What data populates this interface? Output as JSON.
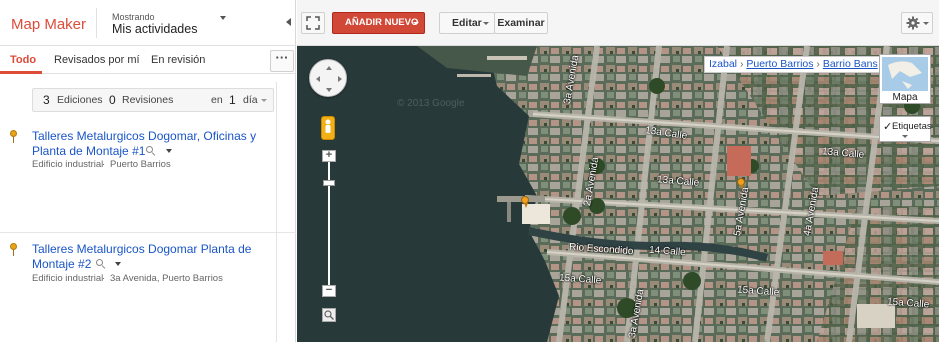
{
  "app": {
    "logo": "Map Maker",
    "showing_label": "Mostrando",
    "showing_value": "Mis actividades"
  },
  "tabs": [
    {
      "label": "Todo",
      "active": true
    },
    {
      "label": "Revisados por mí",
      "active": false
    },
    {
      "label": "En revisión",
      "active": false
    }
  ],
  "summary": {
    "edits_count": "3",
    "edits_label": "Ediciones",
    "revisions_count": "0",
    "revisions_label": "Revisiones",
    "in_label": "en",
    "days_count": "1",
    "day_label": "día"
  },
  "items": [
    {
      "title_line1": "Talleres Metalurgicos Dogomar, Oficinas y",
      "title_line2": "Planta de Montaje #1",
      "category": "Edificio industrial",
      "location": "Puerto Barrios"
    },
    {
      "title_line1": "Talleres Metalurgicos Dogomar Planta de",
      "title_line2": "Montaje #2",
      "category": "Edificio industrial",
      "location": "3a Avenida, Puerto Barrios"
    }
  ],
  "toolbar": {
    "add_new": "AÑADIR NUEVO",
    "edit": "Editar",
    "browse": "Examinar"
  },
  "map": {
    "breadcrumbs": [
      "Izabal",
      "Puerto Barrios",
      "Barrio Bans"
    ],
    "map_type_label": "Mapa",
    "labels_toggle": "Etiquetas",
    "labels_checked": true,
    "watermark": "© 2013 Google",
    "street_labels": [
      "3a Avenida",
      "13a Calle",
      "2a Avenida",
      "5a Avenida",
      "4a Avenida",
      "13a Calle",
      "13a Calle",
      "Rio Escondido",
      "14 Calle",
      "15a Calle",
      "15a Calle",
      "15a Calle",
      "3a Avenida"
    ],
    "colors": {
      "accent": "#dd4b39",
      "link": "#1a55c8",
      "pin": "#e8a317"
    }
  },
  "icons": {
    "fullscreen": "expand-icon",
    "gear": "gear-icon",
    "pan": "pan-control-icon",
    "pegman": "pegman-icon",
    "lasso": "lasso-zoom-icon",
    "magnifier": "search-icon"
  }
}
